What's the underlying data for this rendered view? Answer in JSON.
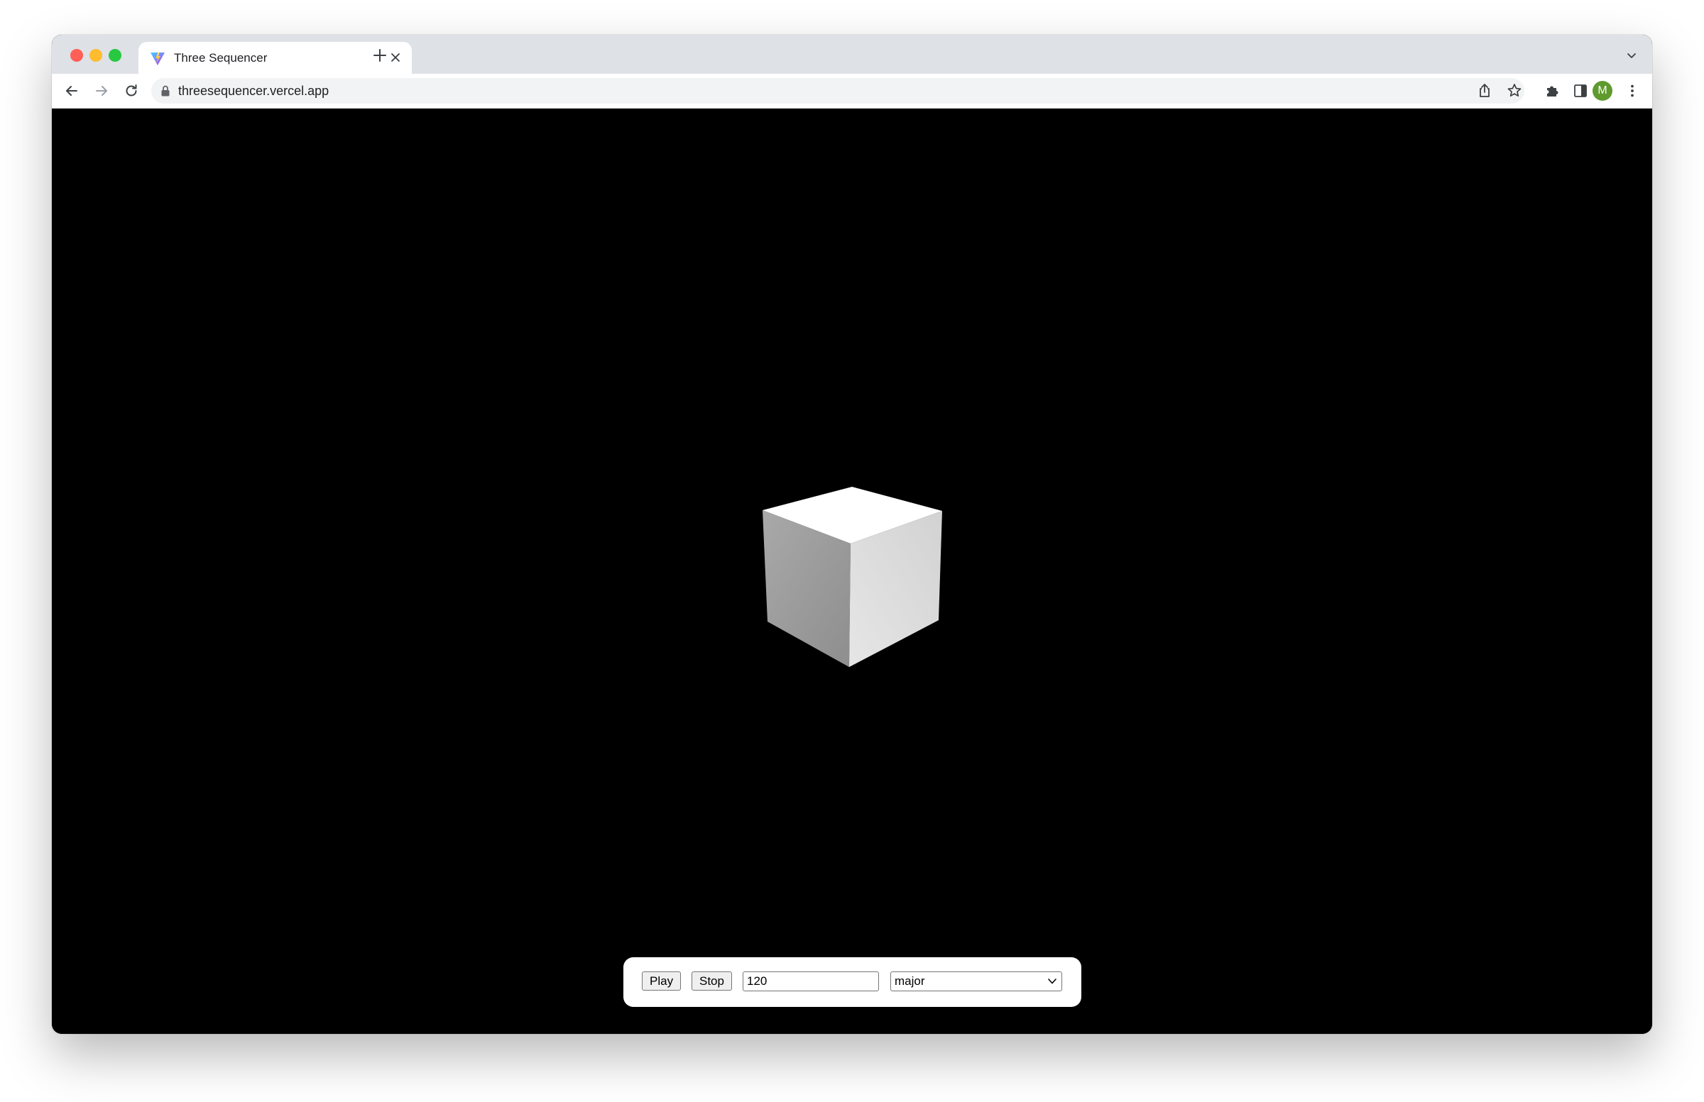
{
  "browser": {
    "tab_title": "Three Sequencer",
    "url": "threesequencer.vercel.app",
    "profile_initial": "M",
    "profile_color": "#5f9a2e"
  },
  "scene": {
    "background_color": "#000000",
    "object": "cube"
  },
  "controls": {
    "play_label": "Play",
    "stop_label": "Stop",
    "tempo_value": "120",
    "scale_selected": "major"
  }
}
